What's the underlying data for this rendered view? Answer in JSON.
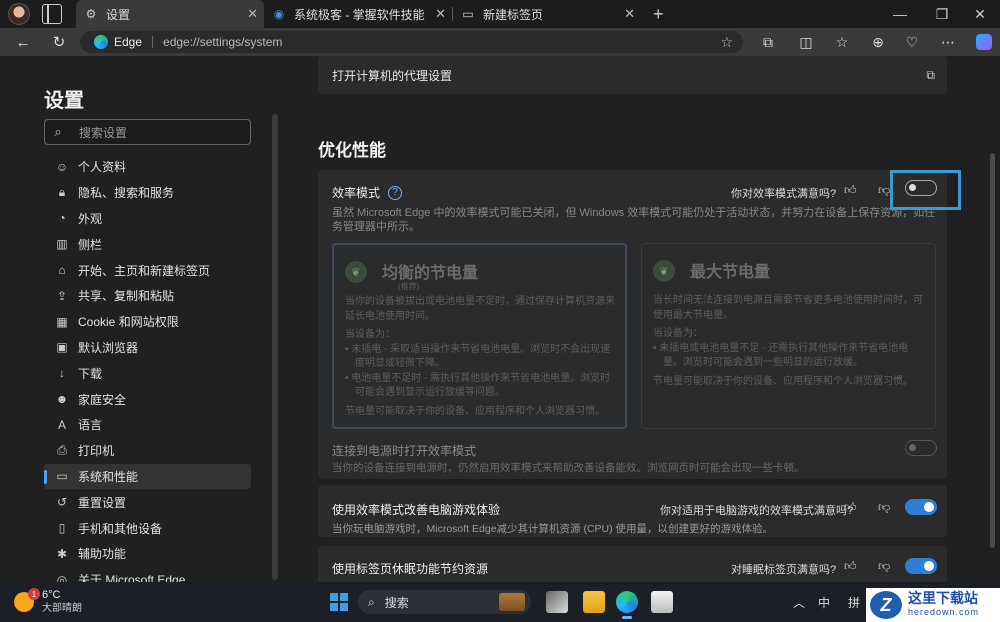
{
  "tabs": [
    {
      "title": "设置",
      "icon": "gear-icon"
    },
    {
      "title": "系统极客 - 掌握软件技能",
      "icon": "site-icon"
    },
    {
      "title": "新建标签页",
      "icon": "newtab-page-icon"
    }
  ],
  "address": {
    "brand": "Edge",
    "url": "edge://settings/system"
  },
  "sidebar": {
    "title": "设置",
    "search_placeholder": "搜索设置",
    "items": [
      {
        "label": "个人资料",
        "icon": "profile-icon"
      },
      {
        "label": "隐私、搜索和服务",
        "icon": "lock-icon"
      },
      {
        "label": "外观",
        "icon": "appearance-icon"
      },
      {
        "label": "侧栏",
        "icon": "sidebar-icon"
      },
      {
        "label": "开始、主页和新建标签页",
        "icon": "home-icon"
      },
      {
        "label": "共享、复制和粘贴",
        "icon": "share-icon"
      },
      {
        "label": "Cookie 和网站权限",
        "icon": "cookie-icon"
      },
      {
        "label": "默认浏览器",
        "icon": "browser-icon"
      },
      {
        "label": "下载",
        "icon": "download-icon"
      },
      {
        "label": "家庭安全",
        "icon": "family-icon"
      },
      {
        "label": "语言",
        "icon": "language-icon"
      },
      {
        "label": "打印机",
        "icon": "printer-icon"
      },
      {
        "label": "系统和性能",
        "icon": "laptop-icon"
      },
      {
        "label": "重置设置",
        "icon": "reset-icon"
      },
      {
        "label": "手机和其他设备",
        "icon": "phone-icon"
      },
      {
        "label": "辅助功能",
        "icon": "accessibility-icon"
      },
      {
        "label": "关于 Microsoft Edge",
        "icon": "edge-icon"
      }
    ],
    "active_index": 12
  },
  "main": {
    "proxy_label": "打开计算机的代理设置",
    "section_title": "优化性能",
    "efficiency": {
      "title": "效率模式",
      "feedback": "你对效率模式满意吗?",
      "enabled": false,
      "description": "虽然 Microsoft Edge 中的效率模式可能已关闭，但 Windows 效率模式可能仍处于活动状态，并努力在设备上保存资源，如任务管理器中所示。",
      "options": [
        {
          "title": "均衡的节电量",
          "tag": "(推荐)",
          "selected": true,
          "intro": "当你的设备被拔出或电池电量不足时，通过保存计算机资源来延长电池使用时间。",
          "when_label": "当设备为：",
          "bullets": [
            "未插电 - 采取适当操作来节省电池电量。浏览时不会出现速度明显或轻微下降。",
            "电池电量不足时 - 需执行其他操作来节省电池电量。浏览时可能会遇到显示运行放缓等问题。"
          ],
          "footer": "节电量可能取决于你的设备、应用程序和个人浏览器习惯。"
        },
        {
          "title": "最大节电量",
          "tag": "",
          "selected": false,
          "intro": "当长时间无法连接到电源且需要节省更多电池使用时间时，可使用最大节电量。",
          "when_label": "当设备为：",
          "bullets": [
            "未插电或电池电量不足 - 还需执行其他操作来节省电池电量。浏览时可能会遇到一些明显的运行放缓。"
          ],
          "footer": "节电量可能取决于你的设备、应用程序和个人浏览器习惯。"
        }
      ],
      "power_title": "连接到电源时打开效率模式",
      "power_desc": "当你的设备连接到电源时，仍然启用效率模式来帮助改善设备能效。浏览网页时可能会出现一些卡顿。"
    },
    "gaming": {
      "title": "使用效率模式改善电脑游戏体验",
      "feedback": "你对适用于电脑游戏的效率模式满意吗?",
      "enabled": true,
      "description": "当你玩电脑游戏时，Microsoft Edge减少其计算机资源 (CPU) 使用量，以创建更好的游戏体验。"
    },
    "sleeping": {
      "title": "使用标签页休眠功能节约资源",
      "feedback": "对睡眠标签页满意吗?",
      "enabled": true
    }
  },
  "taskbar": {
    "weather_temp": "6°C",
    "weather_desc": "大部晴朗",
    "notif_count": "1",
    "search_placeholder": "搜索",
    "ime_lang": "中",
    "ime_mode": "拼"
  },
  "watermark": {
    "line1": "这里下载站",
    "line2": "heredown.com"
  },
  "colors": {
    "accent": "#2d7fd6",
    "highlight": "#3a9ad9",
    "background": "#202020",
    "card": "#2b2b2b"
  }
}
